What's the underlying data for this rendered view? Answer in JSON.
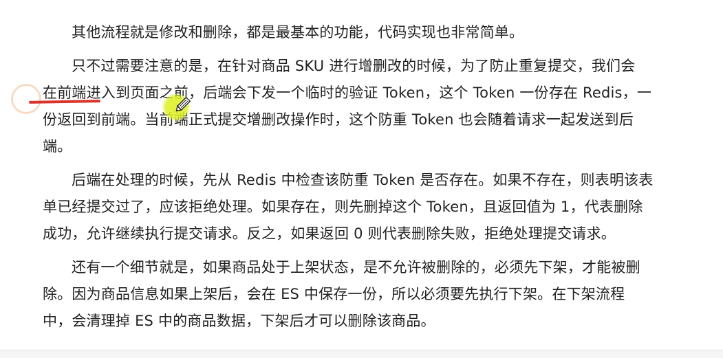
{
  "article": {
    "paragraphs": [
      {
        "lines": [
          "其他流程就是修改和删除，都是最基本的功能，代码实现也非常简单。"
        ]
      },
      {
        "lines": [
          "只不过需要注意的是，在针对商品 SKU 进行增删改的时候，为了防止重复提交，我们会",
          "在前端进入到页面之前，后端会下发一个临时的验证 Token，这个 Token 一份存在 Redis，一",
          "份返回到前端。当前端正式提交增删改操作时，这个防重 Token 也会随着请求一起发送到后",
          "端。"
        ]
      },
      {
        "lines": [
          "后端在处理的时候，先从 Redis 中检查该防重 Token 是否存在。如果不存在，则表明该表",
          "单已经提交过了，应该拒绝处理。如果存在，则先删掉这个 Token，且返回值为 1，代表删除",
          "成功，允许继续执行提交请求。反之，如果返回 0 则代表删除失败，拒绝处理提交请求。"
        ]
      },
      {
        "lines": [
          "还有一个细节就是，如果商品处于上架状态，是不允许被删除的，必须先下架，才能被删",
          "除。因为商品信息如果上架后，会在 ES 中保存一份，所以必须要先执行下架。在下架流程",
          "中，会清理掉 ES 中的商品数据，下架后才可以删除该商品。"
        ]
      }
    ]
  },
  "annotations": {
    "highlighter_color": "#def028",
    "underline_color": "#d9342b",
    "cursor_icon": "pen-cursor-icon"
  }
}
